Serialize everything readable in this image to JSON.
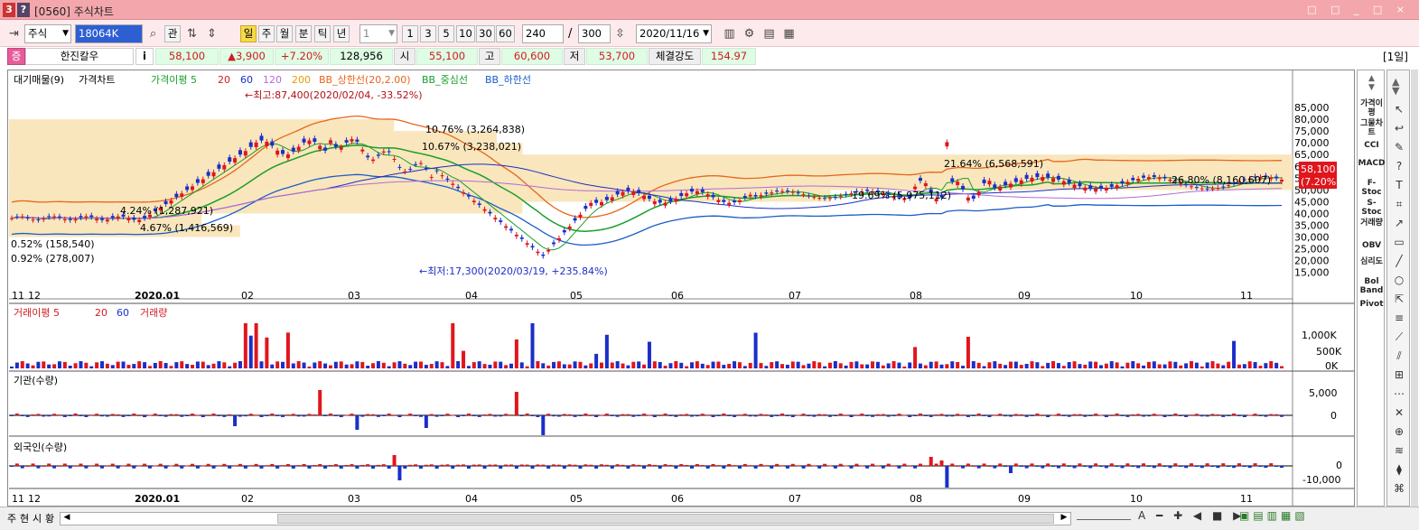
{
  "window": {
    "title": "[0560] 주식차트",
    "logo": "3",
    "help": "?",
    "controls": "□ □ _ □ ×"
  },
  "toolbar": {
    "market": "주식",
    "code": "18064K",
    "btn_gwan": "관",
    "periods": [
      "일",
      "주",
      "월",
      "분",
      "틱",
      "년"
    ],
    "interval_select": "1",
    "intervals": [
      "1",
      "3",
      "5",
      "10",
      "30",
      "60"
    ],
    "count": "240",
    "slash": "/",
    "max_count": "300",
    "date": "2020/11/16"
  },
  "info": {
    "badge": "증",
    "name": "한진칼우",
    "i": "i",
    "price": "58,100",
    "change": "▲3,900",
    "rate": "+7.20%",
    "volume": "128,956",
    "open_label": "시",
    "open": "55,100",
    "high_label": "고",
    "high": "60,600",
    "low_label": "저",
    "low": "53,700",
    "strength_label": "체결강도",
    "strength": "154.97",
    "period_tag": "[1일]"
  },
  "price_legend": {
    "l1": "대기매물(9)",
    "l2": "가격차트",
    "l3": "가격이평 5",
    "l4": "20",
    "l5": "60",
    "l6": "120",
    "l7": "200",
    "l8": "BB_상한선(20,2.00)",
    "l9": "BB_중심선",
    "l10": "BB_하한선"
  },
  "annotations": {
    "max": "←최고:87,400(2020/02/04, -33.52%)",
    "min": "←최저:17,300(2020/03/19, +235.84%)",
    "a1": "10.76% (3,264,838)",
    "a2": "10.67% (3,238,021)",
    "a3": "21.64% (6,568,591)",
    "a4": "26.80% (8,160,607)",
    "a5": "19.69% (5,975,112)",
    "a6": "4.24% (1,287,921)",
    "a7": "4.67% (1,416,569)",
    "a8": "0.52% (158,540)",
    "a9": "0.92% (278,007)"
  },
  "price_axis": [
    "85,000",
    "80,000",
    "75,000",
    "70,000",
    "65,000",
    "60,000",
    "55,000",
    "50,000",
    "45,000",
    "40,000",
    "35,000",
    "30,000",
    "25,000",
    "20,000",
    "15,000"
  ],
  "current_price": {
    "value": "58,100",
    "rate": "(7.20%)"
  },
  "x_axis": [
    "11",
    "12",
    "2020.01",
    "02",
    "03",
    "04",
    "05",
    "06",
    "07",
    "08",
    "09",
    "10",
    "11"
  ],
  "volume_panel": {
    "legend": "거래이평 5",
    "l20": "20",
    "l60": "60",
    "lvol": "거래량",
    "axis": [
      "1,000K",
      "500K",
      "0K"
    ]
  },
  "inst_panel": {
    "legend": "기관(수량)",
    "axis": [
      "5,000",
      "0"
    ]
  },
  "foreign_panel": {
    "legend": "외국인(수량)",
    "axis": [
      "0",
      "-10,000"
    ]
  },
  "right_panel": [
    "가격이평",
    "그물차트",
    "CCI",
    "MACD",
    "F-Stoc",
    "S-Stoc",
    "거래량",
    "OBV",
    "심리도",
    "Bol Band",
    "Pivot"
  ],
  "bottom": {
    "tabs": [
      "주",
      "현",
      "시",
      "황"
    ]
  },
  "colors": {
    "up": "#e0161c",
    "down": "#1a2fc8",
    "titlebar": "#f3a7ad",
    "info_cell": "#dffce4"
  }
}
